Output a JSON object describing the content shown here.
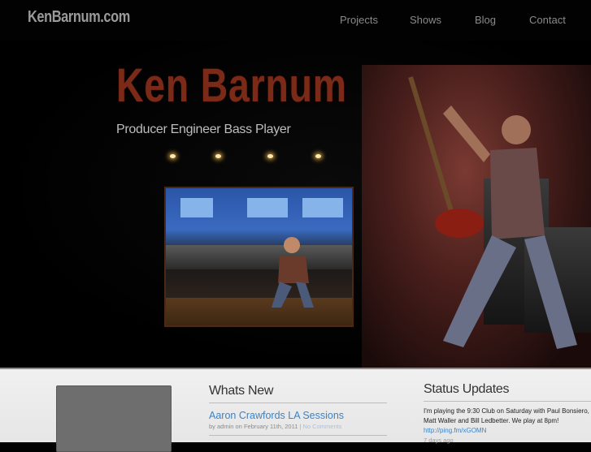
{
  "header": {
    "logo": "KenBarnum.com",
    "nav": [
      "Projects",
      "Shows",
      "Blog",
      "Contact"
    ]
  },
  "hero": {
    "title": "Ken Barnum",
    "subtitle": "Producer Engineer Bass Player"
  },
  "whats_new": {
    "heading": "Whats New",
    "post": {
      "title": "Aaron Crawfords LA Sessions",
      "meta_prefix": "by admin on February 11th, 2011",
      "separator": "|",
      "comments": "No Comments"
    }
  },
  "status_updates": {
    "heading": "Status Updates",
    "line1": "I'm playing the 9:30 Club on Saturday with Paul Bonsiero,",
    "line2": "Matt Waller and Bill Ledbetter. We play at 8pm!",
    "link": "http://ping.fm/xGOMN",
    "time": "7 days ago"
  },
  "colors": {
    "title_accent": "#7a2a17",
    "link": "#3a83c8",
    "background": "#000000",
    "content_background": "#f0f0f0"
  }
}
